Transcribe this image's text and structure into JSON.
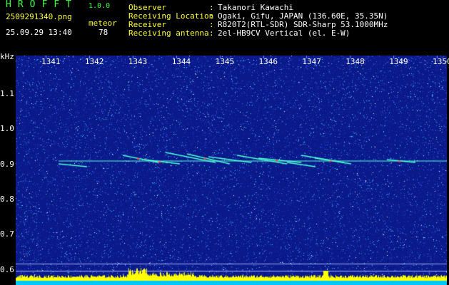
{
  "header": {
    "logo": "HROFFT",
    "version": "1.0.0",
    "filename": "2509291340.png",
    "datetime": "25.09.29 13:40",
    "meteor_label": "meteor",
    "meteor_count": "78"
  },
  "info": [
    {
      "label": "Observer",
      "value": "Takanori Kawachi"
    },
    {
      "label": "Receiving Location",
      "value": "Ogaki, Gifu, JAPAN (136.60E, 35.35N)"
    },
    {
      "label": "Receiver",
      "value": "R820T2(RTL-SDR) SDR-Sharp 53.1000MHz"
    },
    {
      "label": "Receiving antenna",
      "value": "2el-HB9CV Vertical (el. E-W)"
    }
  ],
  "spectrogram": {
    "y_unit": "kHz",
    "y_ticks": [
      "1.1",
      "1.0",
      "0.9",
      "0.8",
      "0.7",
      "0.6"
    ],
    "x_ticks": [
      "1341",
      "1342",
      "1343",
      "1344",
      "1345",
      "1346",
      "1347",
      "1348",
      "1349",
      "1350"
    ],
    "colors": {
      "background": "#0a1a8a",
      "noise_light": "#4a78ff",
      "noise_cyan": "#2fd8ff",
      "trace": "#4dffd2",
      "hot": "#ff3c3c",
      "level_bar": "#ffff00",
      "baseline": "#00c8ff"
    }
  }
}
